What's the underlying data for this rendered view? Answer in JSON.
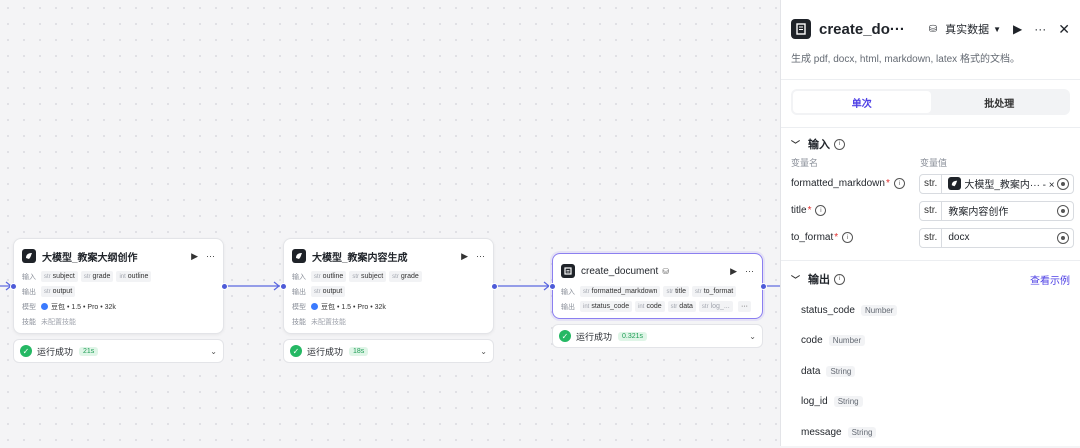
{
  "nodes": [
    {
      "title": "大模型_教案大纲创作",
      "input_label": "输入",
      "inputs": [
        {
          "type": "str",
          "name": "subject"
        },
        {
          "type": "str",
          "name": "grade"
        },
        {
          "type": "int",
          "name": "outline"
        }
      ],
      "output_label": "输出",
      "outputs": [
        {
          "type": "str",
          "name": "output"
        }
      ],
      "model_label": "模型",
      "model": "豆包 • 1.5 • Pro • 32k",
      "skill_label": "技能",
      "skill": "未配置技能",
      "status": "运行成功",
      "time": "21s"
    },
    {
      "title": "大模型_教案内容生成",
      "input_label": "输入",
      "inputs": [
        {
          "type": "str",
          "name": "outline"
        },
        {
          "type": "str",
          "name": "subject"
        },
        {
          "type": "str",
          "name": "grade"
        }
      ],
      "output_label": "输出",
      "outputs": [
        {
          "type": "str",
          "name": "output"
        }
      ],
      "model_label": "模型",
      "model": "豆包 • 1.5 • Pro • 32k",
      "skill_label": "技能",
      "skill": "未配置技能",
      "status": "运行成功",
      "time": "18s"
    },
    {
      "title": "create_document",
      "input_label": "输入",
      "inputs": [
        {
          "type": "str",
          "name": "formatted_markdown"
        },
        {
          "type": "str",
          "name": "title"
        },
        {
          "type": "str",
          "name": "to_format"
        }
      ],
      "output_label": "输出",
      "outputs": [
        {
          "type": "int",
          "name": "status_code"
        },
        {
          "type": "int",
          "name": "code"
        },
        {
          "type": "str",
          "name": "data"
        },
        {
          "type": "str",
          "name": "log_..."
        }
      ],
      "more": "···",
      "status": "运行成功",
      "time": "0.321s"
    }
  ],
  "panel": {
    "title": "create_do···",
    "mode": "真实数据",
    "description": "生成 pdf, docx, html, markdown, latex 格式的文档。",
    "tabs": [
      "单次",
      "批处理"
    ],
    "input_section": "输入",
    "col_name": "变量名",
    "col_value": "变量值",
    "inputs": [
      {
        "name": "formatted_markdown",
        "type": "str.",
        "value": "大模型_教案内··· - ×",
        "is_ref": true
      },
      {
        "name": "title",
        "type": "str.",
        "value": "教案内容创作",
        "is_ref": false
      },
      {
        "name": "to_format",
        "type": "str.",
        "value": "docx",
        "is_ref": false
      }
    ],
    "output_section": "输出",
    "view_example": "查看示例",
    "outputs": [
      {
        "name": "status_code",
        "type": "Number"
      },
      {
        "name": "code",
        "type": "Number"
      },
      {
        "name": "data",
        "type": "String"
      },
      {
        "name": "log_id",
        "type": "String"
      },
      {
        "name": "message",
        "type": "String"
      }
    ]
  },
  "colors": {
    "accent": "#4e40e5",
    "success": "#25b864",
    "edge": "#5a67e0"
  }
}
